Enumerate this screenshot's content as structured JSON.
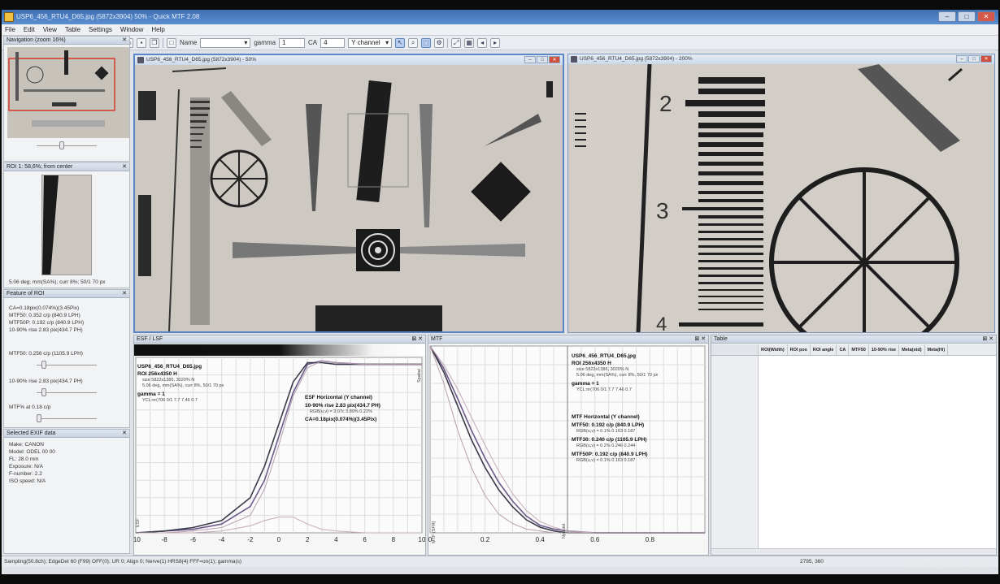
{
  "window": {
    "title": "USP6_456_RTU4_D65.jpg (5872x3904) 50% - Quick MTF 2.08"
  },
  "menu": [
    "File",
    "Edit",
    "View",
    "Table",
    "Settings",
    "Window",
    "Help"
  ],
  "toolbar": {
    "name_label": "Name",
    "gamma_label": "gamma",
    "gamma_value": "1",
    "ca_label": "CA",
    "ca_value": "4",
    "channel": "Y channel"
  },
  "navigation": {
    "title": "Navigation (zoom 16%)"
  },
  "roi": {
    "title": "ROI 1: 58,6%; from center",
    "caption": "5.06 deg; mm(SA%); curr 8%; 50/1 70 px"
  },
  "feature": {
    "title": "Feature of ROI",
    "lines": [
      "CA=0.18pix(0.074%)(3.45Pix)",
      "MTF50: 0.352 c/p (840.9 LPH)",
      "MTF50P: 0.192 c/p (840.9 LPH)",
      "10-90% rise 2.83 pix(434.7 PH)"
    ],
    "mtf_label": "MTF50: 0.256 c/p (1105.9 LPH)",
    "rise_label": "10-90% rise 2.83 pix(434.7 PH)",
    "mtfx_label": "MTF% at 0.18 c/p"
  },
  "exif": {
    "title": "Selected EXIF data",
    "lines": [
      "Make: CANON",
      "Model: ODEL 00 00",
      "FL: 28.0 mm",
      "Exposure: N/A",
      "F-number: 2.2",
      "ISO speed: N/A"
    ]
  },
  "win_left": {
    "title": "USP6_456_RTU4_D65.jpg (5872x3904) - 50%"
  },
  "win_right": {
    "title": "USP6_456_RTU4_D65.jpg (5872x3904) - 200%"
  },
  "esf": {
    "title": "ESF / LSF",
    "file": "USP6_456_RTU4_D65.jpg",
    "roi": "ROI 256x4350 H",
    "sub1": "size 5822x1386, 3020% N",
    "sub2": "5.06 deg, mm(SA%), curr 8%, 50/1 70 px",
    "gamma": "gamma = 1",
    "sub3": "YCL:nr(706 0/1 7.7 7.46 0.7",
    "edge_title": "ESF Horizontal (Y channel)",
    "rise": "10-90% rise 2.83 pix(434.7 PH)",
    "rise_sub": "RGB(u,v) = 3.07c 3.89% 0.22%",
    "ca": "CA=0.18pix(0.074%)(3.45Pix)",
    "ylabel": "ESF",
    "right_label": "Spatial"
  },
  "mtf": {
    "title": "MTF",
    "file": "USP6_456_RTU4_D65.jpg",
    "roi": "ROI 256x4350 H",
    "sub1": "size 5822x1386, 3020% N",
    "sub2": "5.06 deg, mm(SA%), curr 8%, 50/1 70 px",
    "gamma": "gamma = 1",
    "sub3": "YCL:nr(706 0/1 7.7 7.46 0.7",
    "mtf_title": "MTF Horizontal (Y channel)",
    "mtf50": "MTF50: 0.192 c/p (840.9 LPH)",
    "mtf50_sub": "RGB(u,v) = 0.1% 0.163 0.187",
    "mtf30": "MTF30: 0.240 c/p (1105.9 LPH)",
    "mtf30_sub": "RGB(u,v) = 0.2% 0.246 0.244",
    "mtf50p": "MTF50P: 0.192 c/p (840.9 LPH)",
    "mtf50p_sub": "RGB(u,v) = 0.1% 0.163 0.187",
    "ylabel": "MTF (SFR)",
    "right_label": "Nyquist"
  },
  "table": {
    "title": "Table",
    "columns": [
      "ROI(Width)",
      "ROI pos",
      "ROI angle",
      "CA",
      "MTF50",
      "10-90% rise",
      "Meta(std)",
      "Meta(Hi)"
    ]
  },
  "statusbar": "Sampling(50.8ch); EdgeDet 60 (F99) OFF(0); UR 0; Align 0; Nerve(1) HRS8(4) FFF=on(1); gamma(s)",
  "statusbar_right": "2795, 360",
  "watermark": "CSDN @john_dwh",
  "chart_data": [
    {
      "type": "line",
      "title": "",
      "xlabel": "",
      "ylabel": "ESF",
      "xlim": [
        -10,
        10
      ],
      "ylim": [
        0,
        1
      ],
      "x": [
        -10,
        -8,
        -6,
        -4,
        -2,
        -1,
        0,
        1,
        2,
        3,
        4,
        6,
        8,
        10
      ],
      "series": [
        {
          "values": [
            0.0,
            0.01,
            0.02,
            0.05,
            0.15,
            0.3,
            0.55,
            0.8,
            0.96,
            0.98,
            0.97,
            0.96,
            0.96,
            0.96
          ]
        },
        {
          "values": [
            0.0,
            0.01,
            0.03,
            0.07,
            0.2,
            0.38,
            0.62,
            0.86,
            0.97,
            0.97,
            0.96,
            0.96,
            0.96,
            0.96
          ]
        },
        {
          "values": [
            0.0,
            0.0,
            0.01,
            0.03,
            0.1,
            0.25,
            0.5,
            0.78,
            0.94,
            0.98,
            0.97,
            0.96,
            0.96,
            0.96
          ]
        },
        {
          "values": [
            0.0,
            0.0,
            0.0,
            0.01,
            0.04,
            0.07,
            0.09,
            0.09,
            0.05,
            0.02,
            0.01,
            0.0,
            0.0,
            0.0
          ]
        }
      ]
    },
    {
      "type": "line",
      "title": "",
      "xlabel": "",
      "ylabel": "MTF (SFR)",
      "xlim": [
        0,
        1
      ],
      "ylim": [
        0,
        1
      ],
      "x": [
        0,
        0.05,
        0.1,
        0.15,
        0.2,
        0.25,
        0.3,
        0.35,
        0.4,
        0.45,
        0.5,
        0.6,
        0.8,
        1.0
      ],
      "series": [
        {
          "values": [
            1.0,
            0.88,
            0.72,
            0.55,
            0.4,
            0.27,
            0.17,
            0.09,
            0.04,
            0.02,
            0.01,
            0.0,
            0.0,
            0.0
          ]
        },
        {
          "values": [
            1.0,
            0.86,
            0.68,
            0.5,
            0.35,
            0.23,
            0.14,
            0.07,
            0.03,
            0.01,
            0.0,
            0.0,
            0.0,
            0.0
          ]
        },
        {
          "values": [
            1.0,
            0.8,
            0.55,
            0.35,
            0.2,
            0.1,
            0.05,
            0.02,
            0.01,
            0.0,
            0.0,
            0.0,
            0.0,
            0.0
          ]
        },
        {
          "values": [
            1.0,
            0.9,
            0.77,
            0.62,
            0.47,
            0.33,
            0.21,
            0.12,
            0.06,
            0.03,
            0.01,
            0.0,
            0.0,
            0.0
          ]
        }
      ]
    }
  ]
}
